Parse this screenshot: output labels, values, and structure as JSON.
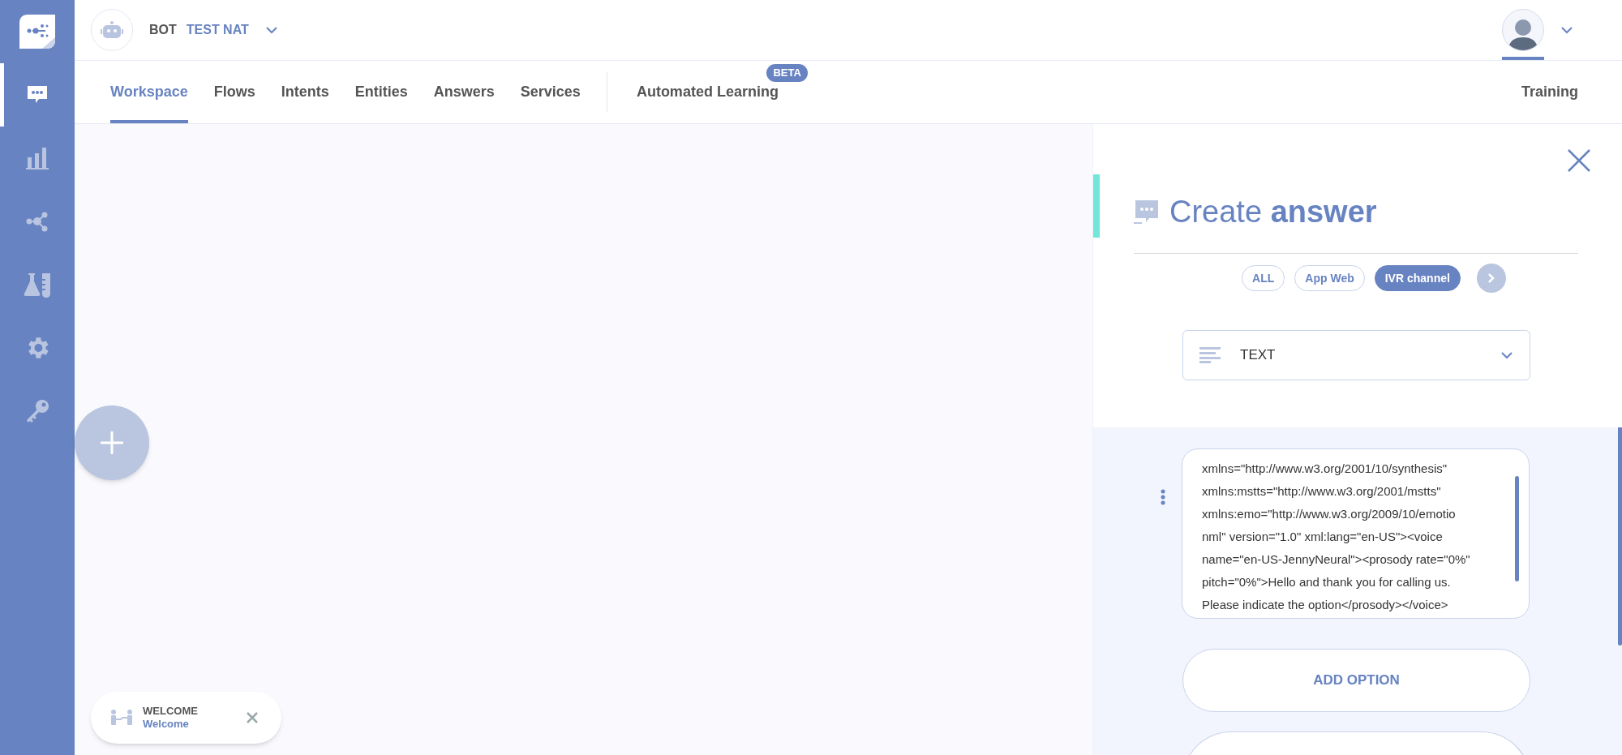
{
  "header": {
    "bot_label": "BOT",
    "bot_name": "TEST NAT"
  },
  "tabs": [
    {
      "label": "Workspace",
      "selected": true
    },
    {
      "label": "Flows",
      "selected": false
    },
    {
      "label": "Intents",
      "selected": false
    },
    {
      "label": "Entities",
      "selected": false
    },
    {
      "label": "Answers",
      "selected": false
    },
    {
      "label": "Services",
      "selected": false
    }
  ],
  "extra_tab": {
    "label": "Automated Learning",
    "badge": "BETA",
    "selected": false
  },
  "training_tab": {
    "label": "Training",
    "selected": false
  },
  "sidebar": [
    {
      "kind": "chat",
      "selected": true
    },
    {
      "kind": "chart",
      "selected": false
    },
    {
      "kind": "network",
      "selected": false
    },
    {
      "kind": "lab",
      "selected": false
    },
    {
      "kind": "settings",
      "selected": false
    },
    {
      "kind": "key",
      "selected": false
    }
  ],
  "canvas": {
    "node": {
      "title": "WELCOME",
      "subtitle": "Welcome"
    }
  },
  "panel": {
    "title": "Create",
    "title_bold": "answer",
    "channels": [
      {
        "label": "ALL",
        "selected": false
      },
      {
        "label": "App Web",
        "selected": false
      },
      {
        "label": "IVR channel",
        "selected": true
      }
    ],
    "type_select": {
      "value": "TEXT"
    },
    "message_lines": [
      "xmlns=\"http://www.w3.org/2001/10/synthesis\"",
      "xmlns:mstts=\"http://www.w3.org/2001/mstts\"",
      "xmlns:emo=\"http://www.w3.org/2009/10/emotio",
      "nml\" version=\"1.0\" xml:lang=\"en-US\"><voice",
      "name=\"en-US-JennyNeural\"><prosody rate=\"0%\"",
      "pitch=\"0%\">Hello and thank you for calling us.",
      "Please indicate the option</prosody></voice>"
    ],
    "add_option": "ADD OPTION"
  }
}
